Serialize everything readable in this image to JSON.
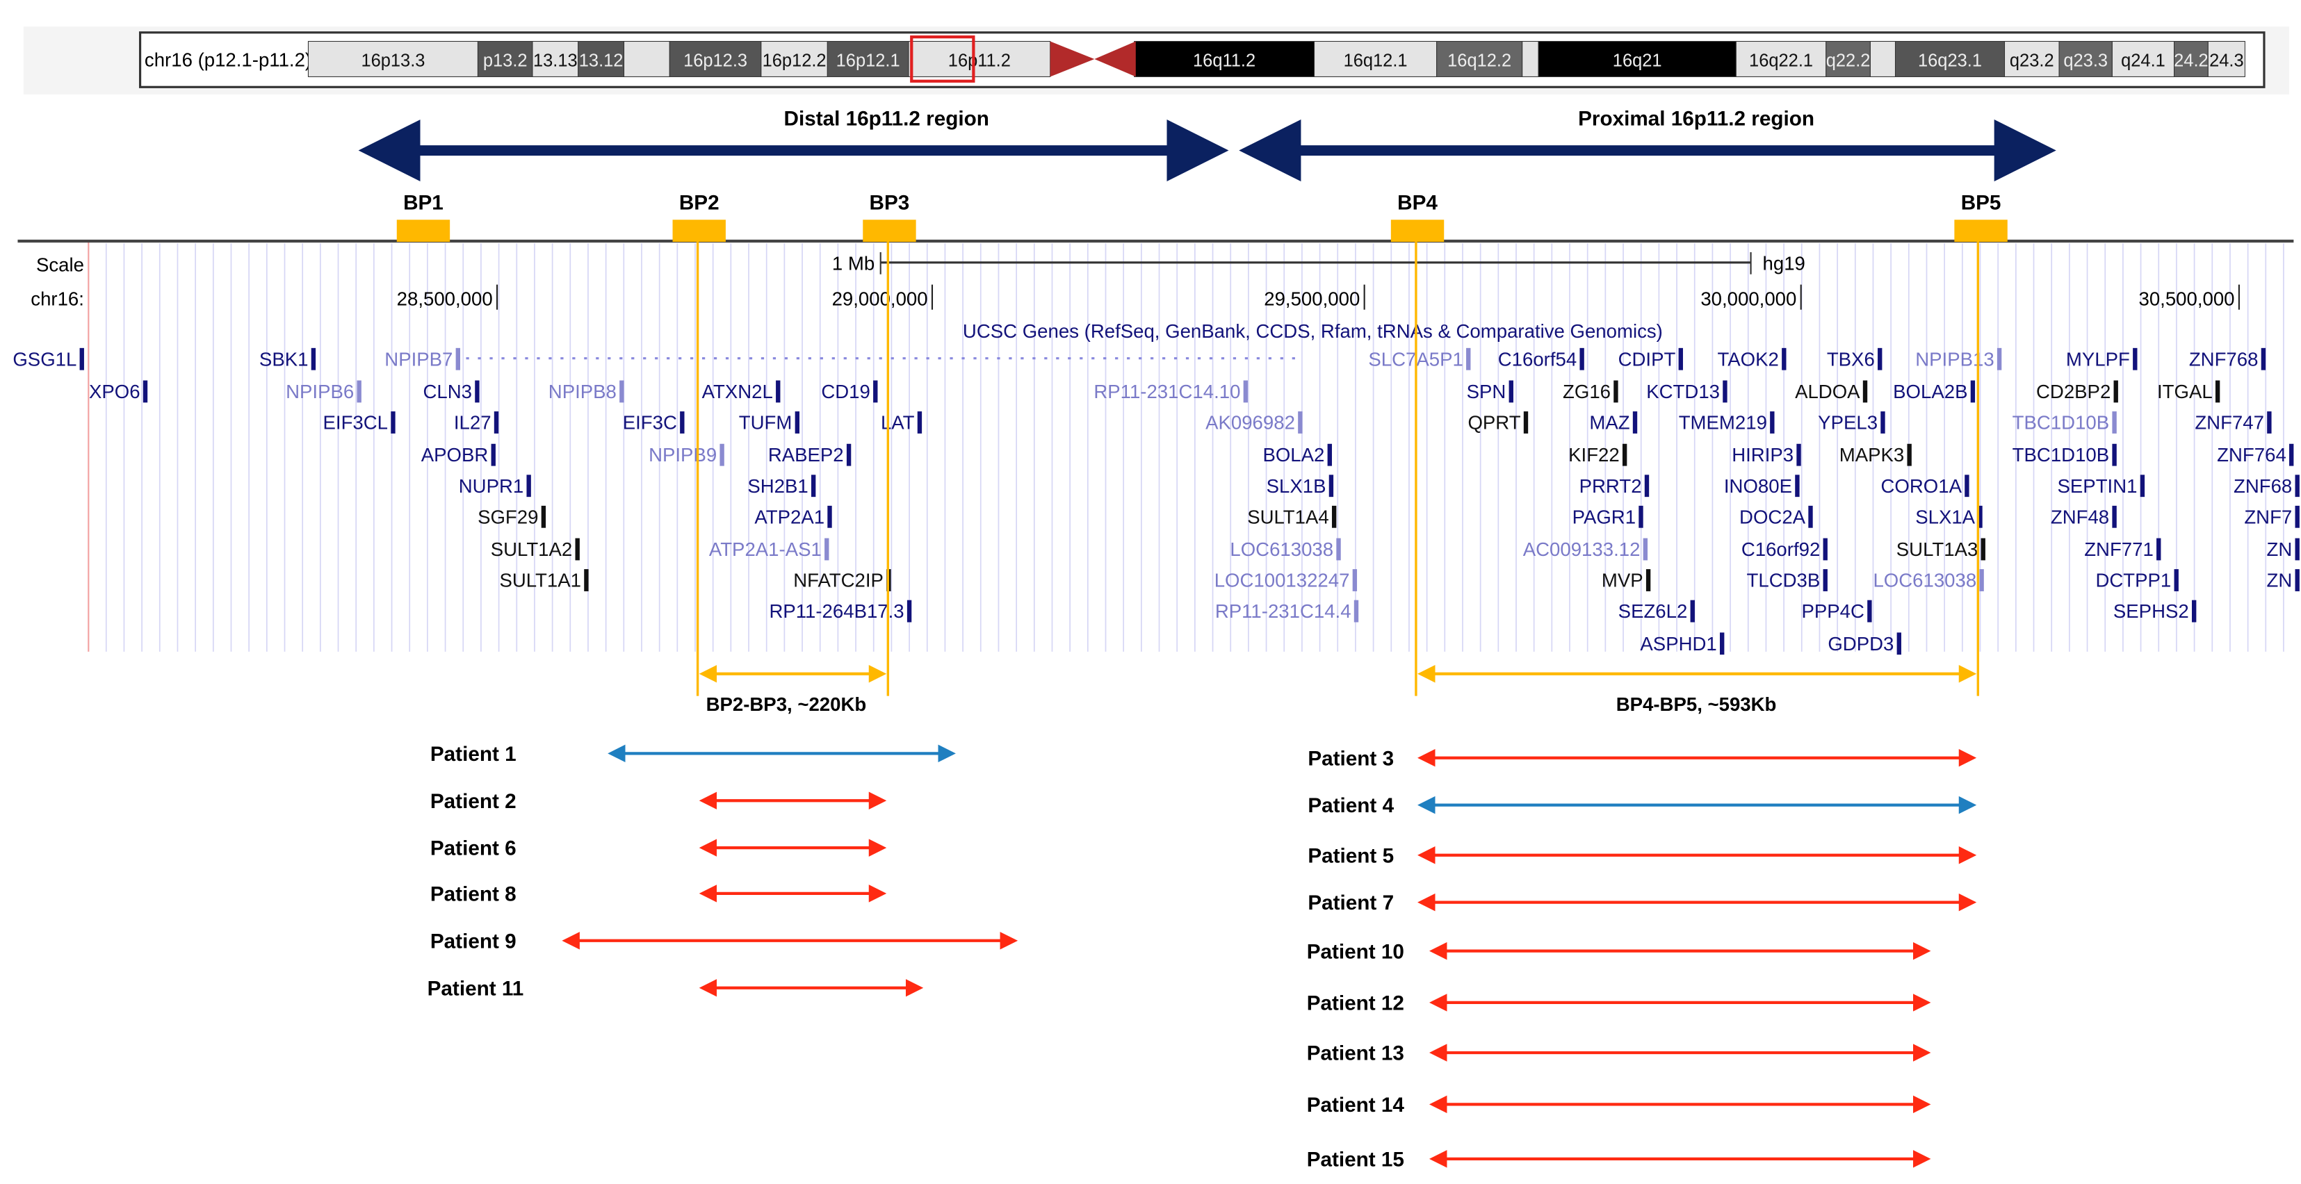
{
  "ideogram": {
    "label": "chr16 (p12.1-p11.2)",
    "bands": [
      {
        "name": "16p13.3",
        "shade": "light"
      },
      {
        "name": "p13.2",
        "shade": "dark"
      },
      {
        "name": "13.13",
        "shade": "light"
      },
      {
        "name": "13.12",
        "shade": "dark"
      },
      {
        "name": "",
        "shade": "light"
      },
      {
        "name": "16p12.3",
        "shade": "dark"
      },
      {
        "name": "16p12.2",
        "shade": "light"
      },
      {
        "name": "16p12.1",
        "shade": "dark"
      },
      {
        "name": "16p11.2",
        "shade": "light"
      },
      {
        "name": "16q11.2",
        "shade": "black"
      },
      {
        "name": "16q12.1",
        "shade": "light"
      },
      {
        "name": "16q12.2",
        "shade": "gray"
      },
      {
        "name": "",
        "shade": "light"
      },
      {
        "name": "16q21",
        "shade": "black"
      },
      {
        "name": "16q22.1",
        "shade": "light"
      },
      {
        "name": "q22.2",
        "shade": "gray"
      },
      {
        "name": "",
        "shade": "light"
      },
      {
        "name": "16q23.1",
        "shade": "dark"
      },
      {
        "name": "q23.2",
        "shade": "light"
      },
      {
        "name": "q23.3",
        "shade": "gray"
      },
      {
        "name": "q24.1",
        "shade": "light"
      },
      {
        "name": "24.2",
        "shade": "gray"
      },
      {
        "name": "24.3",
        "shade": "light"
      }
    ]
  },
  "regions": {
    "distal": "Distal 16p11.2 region",
    "proximal": "Proximal 16p11.2 region"
  },
  "breakpoints": [
    "BP1",
    "BP2",
    "BP3",
    "BP4",
    "BP5"
  ],
  "browser": {
    "scale_label": "Scale",
    "chrom_label": "chr16:",
    "scale_bar": "1 Mb",
    "assembly": "hg19",
    "ticks": [
      "28,500,000",
      "29,000,000",
      "29,500,000",
      "30,000,000",
      "30,500,000"
    ],
    "track_title": "UCSC Genes (RefSeq, GenBank, CCDS, Rfam, tRNAs & Comparative Genomics)"
  },
  "genes": [
    {
      "name": "GSG1L",
      "s": "dark"
    },
    {
      "name": "SBK1",
      "s": "dark"
    },
    {
      "name": "NPIPB7",
      "s": "light"
    },
    {
      "name": "SLC7A5P1",
      "s": "light"
    },
    {
      "name": "C16orf54",
      "s": "dark"
    },
    {
      "name": "CDIPT",
      "s": "dark"
    },
    {
      "name": "TAOK2",
      "s": "dark"
    },
    {
      "name": "TBX6",
      "s": "dark"
    },
    {
      "name": "NPIPB13",
      "s": "light"
    },
    {
      "name": "MYLPF",
      "s": "dark"
    },
    {
      "name": "ZNF768",
      "s": "dark"
    },
    {
      "name": "XPO6",
      "s": "dark"
    },
    {
      "name": "NPIPB6",
      "s": "light"
    },
    {
      "name": "CLN3",
      "s": "dark"
    },
    {
      "name": "NPIPB8",
      "s": "light"
    },
    {
      "name": "ATXN2L",
      "s": "dark"
    },
    {
      "name": "CD19",
      "s": "dark"
    },
    {
      "name": "RP11-231C14.10",
      "s": "light"
    },
    {
      "name": "SPN",
      "s": "dark"
    },
    {
      "name": "ZG16",
      "s": "black"
    },
    {
      "name": "KCTD13",
      "s": "dark"
    },
    {
      "name": "ALDOA",
      "s": "black"
    },
    {
      "name": "BOLA2B",
      "s": "dark"
    },
    {
      "name": "CD2BP2",
      "s": "black"
    },
    {
      "name": "ITGAL",
      "s": "black"
    },
    {
      "name": "EIF3CL",
      "s": "dark"
    },
    {
      "name": "IL27",
      "s": "dark"
    },
    {
      "name": "EIF3C",
      "s": "dark"
    },
    {
      "name": "TUFM",
      "s": "dark"
    },
    {
      "name": "LAT",
      "s": "dark"
    },
    {
      "name": "AK096982",
      "s": "light"
    },
    {
      "name": "QPRT",
      "s": "black"
    },
    {
      "name": "MAZ",
      "s": "dark"
    },
    {
      "name": "TMEM219",
      "s": "dark"
    },
    {
      "name": "YPEL3",
      "s": "dark"
    },
    {
      "name": "TBC1D10B",
      "s": "light"
    },
    {
      "name": "ZNF747",
      "s": "dark"
    },
    {
      "name": "APOBR",
      "s": "dark"
    },
    {
      "name": "NPIPB9",
      "s": "light"
    },
    {
      "name": "RABEP2",
      "s": "dark"
    },
    {
      "name": "BOLA2",
      "s": "dark"
    },
    {
      "name": "KIF22",
      "s": "black"
    },
    {
      "name": "HIRIP3",
      "s": "dark"
    },
    {
      "name": "MAPK3",
      "s": "black"
    },
    {
      "name": "TBC1D10B",
      "s": "dark"
    },
    {
      "name": "ZNF764",
      "s": "dark"
    },
    {
      "name": "NUPR1",
      "s": "dark"
    },
    {
      "name": "SH2B1",
      "s": "dark"
    },
    {
      "name": "SLX1B",
      "s": "dark"
    },
    {
      "name": "PRRT2",
      "s": "dark"
    },
    {
      "name": "INO80E",
      "s": "dark"
    },
    {
      "name": "CORO1A",
      "s": "dark"
    },
    {
      "name": "SEPTIN1",
      "s": "dark"
    },
    {
      "name": "ZNF68",
      "s": "dark"
    },
    {
      "name": "SGF29",
      "s": "black"
    },
    {
      "name": "ATP2A1",
      "s": "dark"
    },
    {
      "name": "SULT1A4",
      "s": "black"
    },
    {
      "name": "PAGR1",
      "s": "dark"
    },
    {
      "name": "DOC2A",
      "s": "dark"
    },
    {
      "name": "SLX1A",
      "s": "dark"
    },
    {
      "name": "ZNF48",
      "s": "dark"
    },
    {
      "name": "ZNF7",
      "s": "dark"
    },
    {
      "name": "SULT1A2",
      "s": "black"
    },
    {
      "name": "ATP2A1-AS1",
      "s": "light"
    },
    {
      "name": "LOC613038",
      "s": "light"
    },
    {
      "name": "AC009133.12",
      "s": "light"
    },
    {
      "name": "C16orf92",
      "s": "dark"
    },
    {
      "name": "SULT1A3",
      "s": "black"
    },
    {
      "name": "ZNF771",
      "s": "dark"
    },
    {
      "name": "ZN",
      "s": "dark"
    },
    {
      "name": "SULT1A1",
      "s": "black"
    },
    {
      "name": "NFATC2IP",
      "s": "black"
    },
    {
      "name": "LOC100132247",
      "s": "light"
    },
    {
      "name": "MVP",
      "s": "black"
    },
    {
      "name": "TLCD3B",
      "s": "dark"
    },
    {
      "name": "LOC613038",
      "s": "light"
    },
    {
      "name": "DCTPP1",
      "s": "dark"
    },
    {
      "name": "ZN",
      "s": "dark"
    },
    {
      "name": "RP11-264B17.3",
      "s": "dark"
    },
    {
      "name": "RP11-231C14.4",
      "s": "light"
    },
    {
      "name": "SEZ6L2",
      "s": "dark"
    },
    {
      "name": "PPP4C",
      "s": "dark"
    },
    {
      "name": "SEPHS2",
      "s": "dark"
    },
    {
      "name": "ASPHD1",
      "s": "dark"
    },
    {
      "name": "GDPD3",
      "s": "dark"
    }
  ],
  "intervals": {
    "bp2_bp3": "BP2-BP3, ~220Kb",
    "bp4_bp5": "BP4-BP5, ~593Kb"
  },
  "patients": [
    {
      "label": "Patient 1",
      "type": "blue"
    },
    {
      "label": "Patient 2",
      "type": "red"
    },
    {
      "label": "Patient 6",
      "type": "red"
    },
    {
      "label": "Patient 8",
      "type": "red"
    },
    {
      "label": "Patient 9",
      "type": "red"
    },
    {
      "label": "Patient 11",
      "type": "red"
    },
    {
      "label": "Patient 3",
      "type": "red"
    },
    {
      "label": "Patient 4",
      "type": "blue"
    },
    {
      "label": "Patient 5",
      "type": "red"
    },
    {
      "label": "Patient 7",
      "type": "red"
    },
    {
      "label": "Patient 10",
      "type": "red"
    },
    {
      "label": "Patient 12",
      "type": "red"
    },
    {
      "label": "Patient 13",
      "type": "red"
    },
    {
      "label": "Patient 14",
      "type": "red"
    },
    {
      "label": "Patient 15",
      "type": "red"
    }
  ],
  "colors": {
    "navy": "#0b2160",
    "bp": "#ffb800",
    "red": "#ff2a12",
    "blue": "#1f7fc0",
    "light": "#e4e4e4",
    "dark": "#555555",
    "gray": "#666666",
    "black": "#000000",
    "centromere": "#b22a2a"
  }
}
